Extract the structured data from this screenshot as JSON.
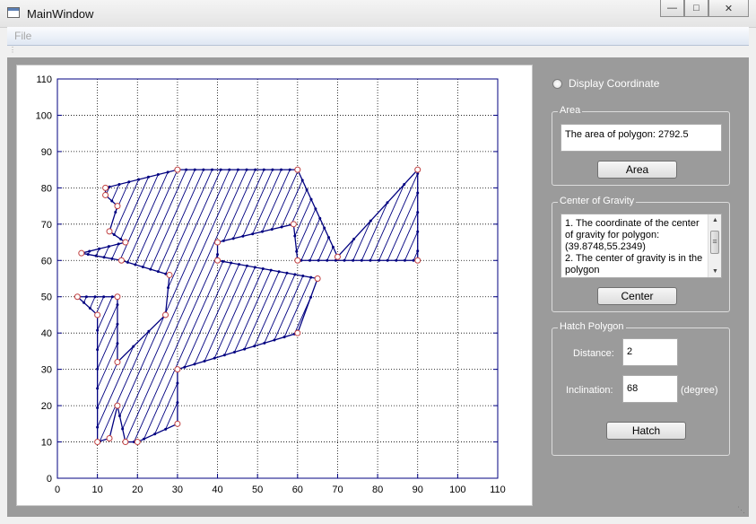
{
  "window": {
    "title": "MainWindow",
    "icon": "app-window-icon"
  },
  "window_controls": {
    "minimize": "minimize-icon",
    "maximize": "maximize-icon",
    "close": "close-icon"
  },
  "menu": {
    "file_label": "File"
  },
  "chart_data": {
    "type": "line",
    "title": "",
    "xlabel": "",
    "ylabel": "",
    "xlim": [
      0,
      110
    ],
    "ylim": [
      0,
      110
    ],
    "xticks": [
      0,
      10,
      20,
      30,
      40,
      50,
      60,
      70,
      80,
      90,
      100,
      110
    ],
    "yticks": [
      0,
      10,
      20,
      30,
      40,
      50,
      60,
      70,
      80,
      90,
      100,
      110
    ],
    "grid": true,
    "colors": {
      "polygon": "#000080",
      "hatch": "#000080",
      "vertex_marker": "#c04040"
    },
    "polygon_vertices": [
      [
        12,
        80
      ],
      [
        30,
        85
      ],
      [
        60,
        85
      ],
      [
        70,
        61
      ],
      [
        90,
        85
      ],
      [
        90,
        60
      ],
      [
        60,
        60
      ],
      [
        59,
        70
      ],
      [
        40,
        65
      ],
      [
        40,
        60
      ],
      [
        65,
        55
      ],
      [
        60,
        40
      ],
      [
        30,
        30
      ],
      [
        30,
        15
      ],
      [
        20,
        10
      ],
      [
        17,
        10
      ],
      [
        15,
        20
      ],
      [
        13,
        11
      ],
      [
        10,
        10
      ],
      [
        10,
        45
      ],
      [
        5,
        50
      ],
      [
        15,
        50
      ],
      [
        15,
        32
      ],
      [
        27,
        45
      ],
      [
        28,
        56
      ],
      [
        16,
        60
      ],
      [
        6,
        62
      ],
      [
        17,
        65
      ],
      [
        13,
        68
      ],
      [
        15,
        75
      ],
      [
        12,
        78
      ]
    ],
    "hatch": {
      "distance": 2,
      "inclination_degrees": 68
    }
  },
  "controls": {
    "display_coordinate_label": "Display Coordinate",
    "area_group": {
      "title": "Area",
      "text": "The area of polygon:  2792.5",
      "button": "Area"
    },
    "center_group": {
      "title": "Center of Gravity",
      "line1": "1.  The coordinate of the center of gravity for polygon:",
      "line2": "(39.8748,55.2349)",
      "line3": "2.  The center of gravity is in the polygon",
      "button": "Center"
    },
    "hatch_group": {
      "title": "Hatch Polygon",
      "distance_label": "Distance:",
      "distance_value": "2",
      "inclination_label": "Inclination:",
      "inclination_value": "68",
      "unit": "(degree)",
      "button": "Hatch"
    }
  }
}
